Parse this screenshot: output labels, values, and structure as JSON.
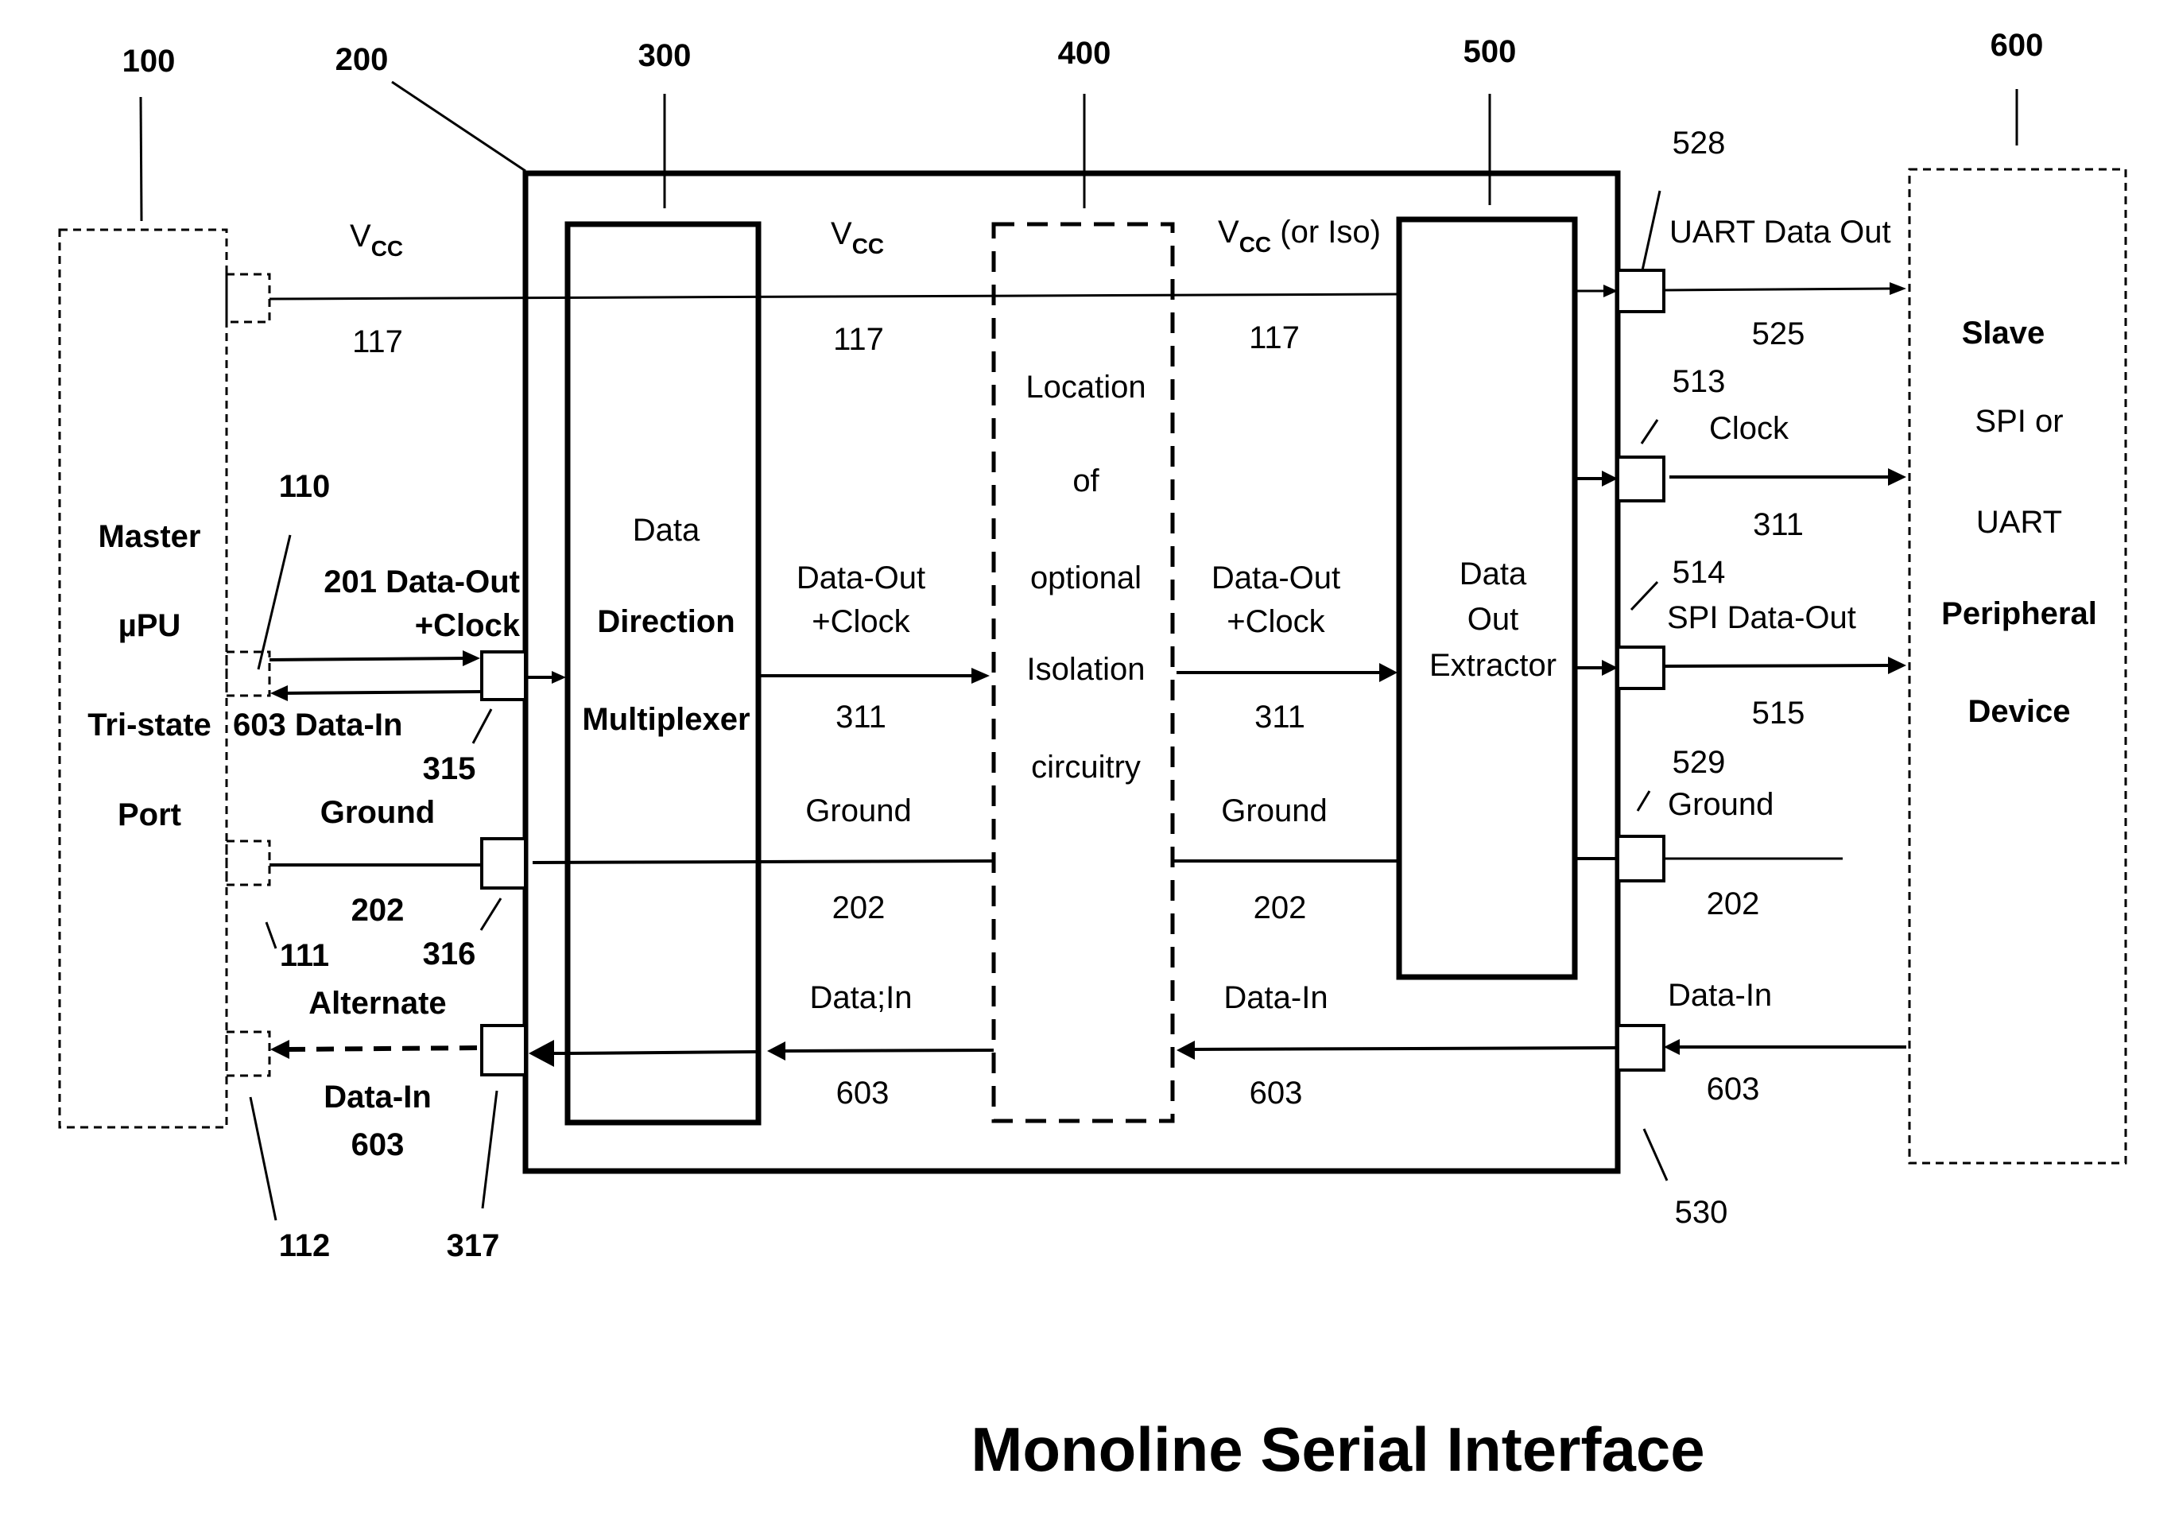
{
  "title": "Monoline Serial Interface",
  "components": {
    "master": {
      "ref": "100",
      "lines": [
        "Master",
        "µPU",
        "Tri-state",
        "Port"
      ]
    },
    "interface": {
      "ref": "200"
    },
    "mux": {
      "ref": "300",
      "lines": [
        "Data",
        "Direction",
        "Multiplexer"
      ]
    },
    "isolation": {
      "ref": "400",
      "lines": [
        "Location",
        "of",
        "optional",
        "Isolation",
        "circuitry"
      ]
    },
    "extractor": {
      "ref": "500",
      "lines": [
        "Data",
        "Out",
        "Extractor"
      ]
    },
    "slave": {
      "ref": "600",
      "lines": [
        "Slave",
        "SPI or",
        "UART",
        "Peripheral",
        "Device"
      ]
    }
  },
  "pins": {
    "p110": "110",
    "p111": "111",
    "p112": "112",
    "p315": "315",
    "p316": "316",
    "p317": "317",
    "p528": "528",
    "p513": "513",
    "p514": "514",
    "p529": "529",
    "p530": "530"
  },
  "signals": {
    "vcc": "V",
    "vcc_sub": "CC",
    "vcc_iso_suffix": " (or Iso)",
    "vcc_ref": "117",
    "data_out_clock_left": "201 Data-Out",
    "plus_clock": "+Clock",
    "data_in_left": "603 Data-In",
    "data_out": "Data-Out",
    "data_out_ref": "311",
    "ground": "Ground",
    "ground_ref": "202",
    "data_in": "Data-In",
    "data_in_mux": "Data;In",
    "data_in_ref": "603",
    "alternate": "Alternate",
    "uart_data_out": "UART Data Out",
    "uart_ref": "525",
    "clock": "Clock",
    "clock_ref": "311",
    "spi_data_out": "SPI Data-Out",
    "spi_ref": "515"
  }
}
